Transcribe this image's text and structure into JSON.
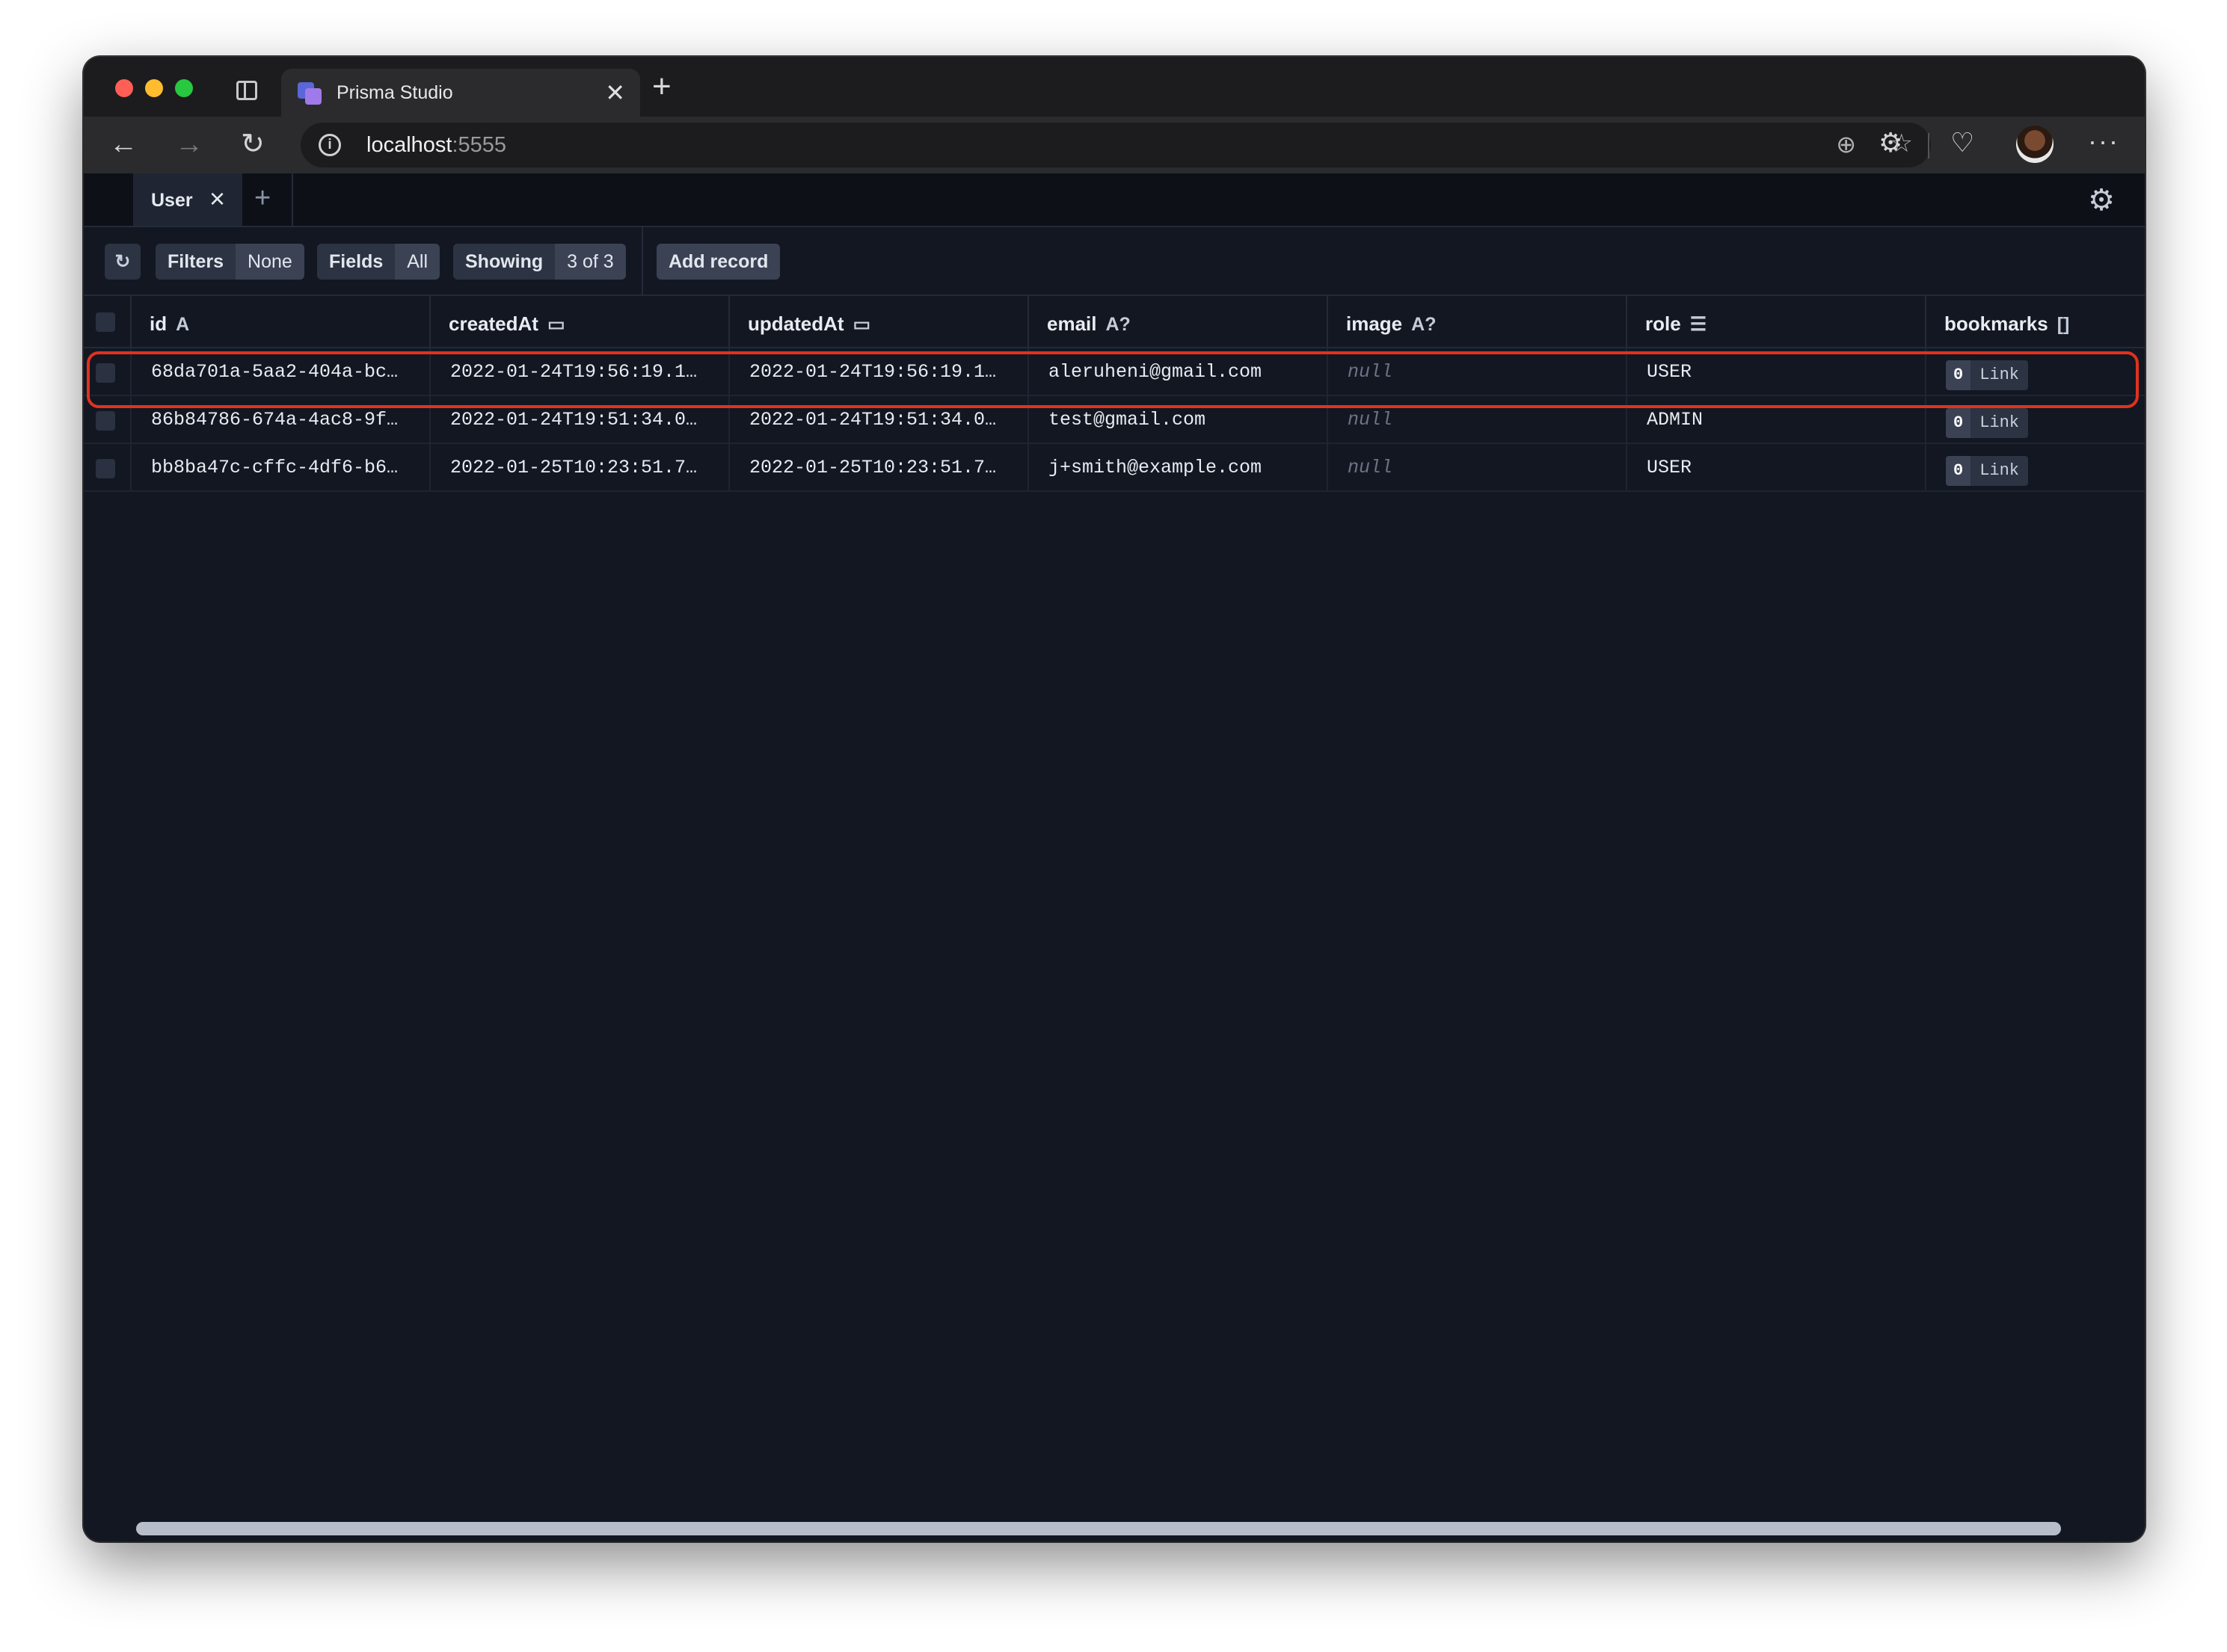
{
  "browser": {
    "tab_title": "Prisma Studio",
    "url_host": "localhost",
    "url_port": ":5555"
  },
  "studio": {
    "model_tab": "User"
  },
  "toolbar": {
    "filters_label": "Filters",
    "filters_value": "None",
    "fields_label": "Fields",
    "fields_value": "All",
    "showing_label": "Showing",
    "showing_value": "3 of 3",
    "add_record": "Add record"
  },
  "table": {
    "columns": [
      {
        "name": "id",
        "type": "A"
      },
      {
        "name": "createdAt",
        "type": "▭"
      },
      {
        "name": "updatedAt",
        "type": "▭"
      },
      {
        "name": "email",
        "type": "A?"
      },
      {
        "name": "image",
        "type": "A?"
      },
      {
        "name": "role",
        "type": "☰"
      },
      {
        "name": "bookmarks",
        "type": "[]"
      }
    ],
    "rows": [
      {
        "id": "68da701a-5aa2-404a-bc…",
        "createdAt": "2022-01-24T19:56:19.1…",
        "updatedAt": "2022-01-24T19:56:19.1…",
        "email": "aleruheni@gmail.com",
        "image": "null",
        "role": "USER",
        "bookmarks_count": "0",
        "bookmarks_link": "Link"
      },
      {
        "id": "86b84786-674a-4ac8-9f…",
        "createdAt": "2022-01-24T19:51:34.0…",
        "updatedAt": "2022-01-24T19:51:34.0…",
        "email": "test@gmail.com",
        "image": "null",
        "role": "ADMIN",
        "bookmarks_count": "0",
        "bookmarks_link": "Link"
      },
      {
        "id": "bb8ba47c-cffc-4df6-b6…",
        "createdAt": "2022-01-25T10:23:51.7…",
        "updatedAt": "2022-01-25T10:23:51.7…",
        "email": "j+smith@example.com",
        "image": "null",
        "role": "USER",
        "bookmarks_count": "0",
        "bookmarks_link": "Link"
      }
    ]
  },
  "colors": {
    "background": "#131722",
    "highlight": "#e0321e"
  }
}
